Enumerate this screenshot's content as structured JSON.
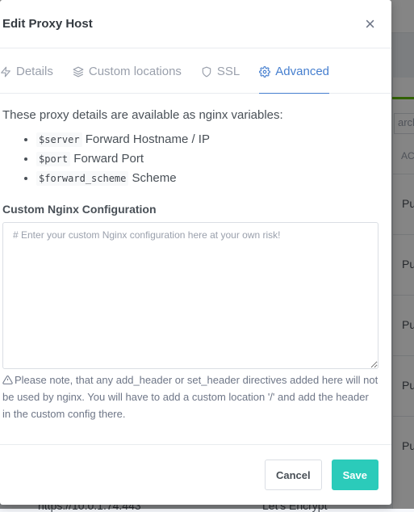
{
  "background": {
    "search_placeholder": "arch",
    "column_header": "AC",
    "row_text": [
      "Pu",
      "Pu",
      "Pu",
      "Pu",
      "Pu"
    ],
    "bottom_left": "https://10.0.1.74:443",
    "bottom_right": "Let's Encrypt"
  },
  "modal": {
    "title": "Edit Proxy Host",
    "close_glyph": "×"
  },
  "tabs": [
    {
      "label": "Details",
      "icon": "zap-icon",
      "active": false
    },
    {
      "label": "Custom locations",
      "icon": "layers-icon",
      "active": false
    },
    {
      "label": "SSL",
      "icon": "shield-icon",
      "active": false
    },
    {
      "label": "Advanced",
      "icon": "gear-icon",
      "active": true
    }
  ],
  "advanced": {
    "intro": "These proxy details are available as nginx variables:",
    "variables": [
      {
        "code": "$server",
        "desc": "Forward Hostname / IP"
      },
      {
        "code": "$port",
        "desc": "Forward Port"
      },
      {
        "code": "$forward_scheme",
        "desc": "Scheme"
      }
    ],
    "config_label": "Custom Nginx Configuration",
    "config_placeholder": "# Enter your custom Nginx configuration here at your own risk!",
    "config_value": "",
    "note": "Please note, that any add_header or set_header directives added here will not be used by nginx. You will have to add a custom location '/' and add the header in the custom config there."
  },
  "footer": {
    "cancel_label": "Cancel",
    "save_label": "Save"
  },
  "colors": {
    "accent": "#467fcf",
    "save": "#2bcbba"
  }
}
